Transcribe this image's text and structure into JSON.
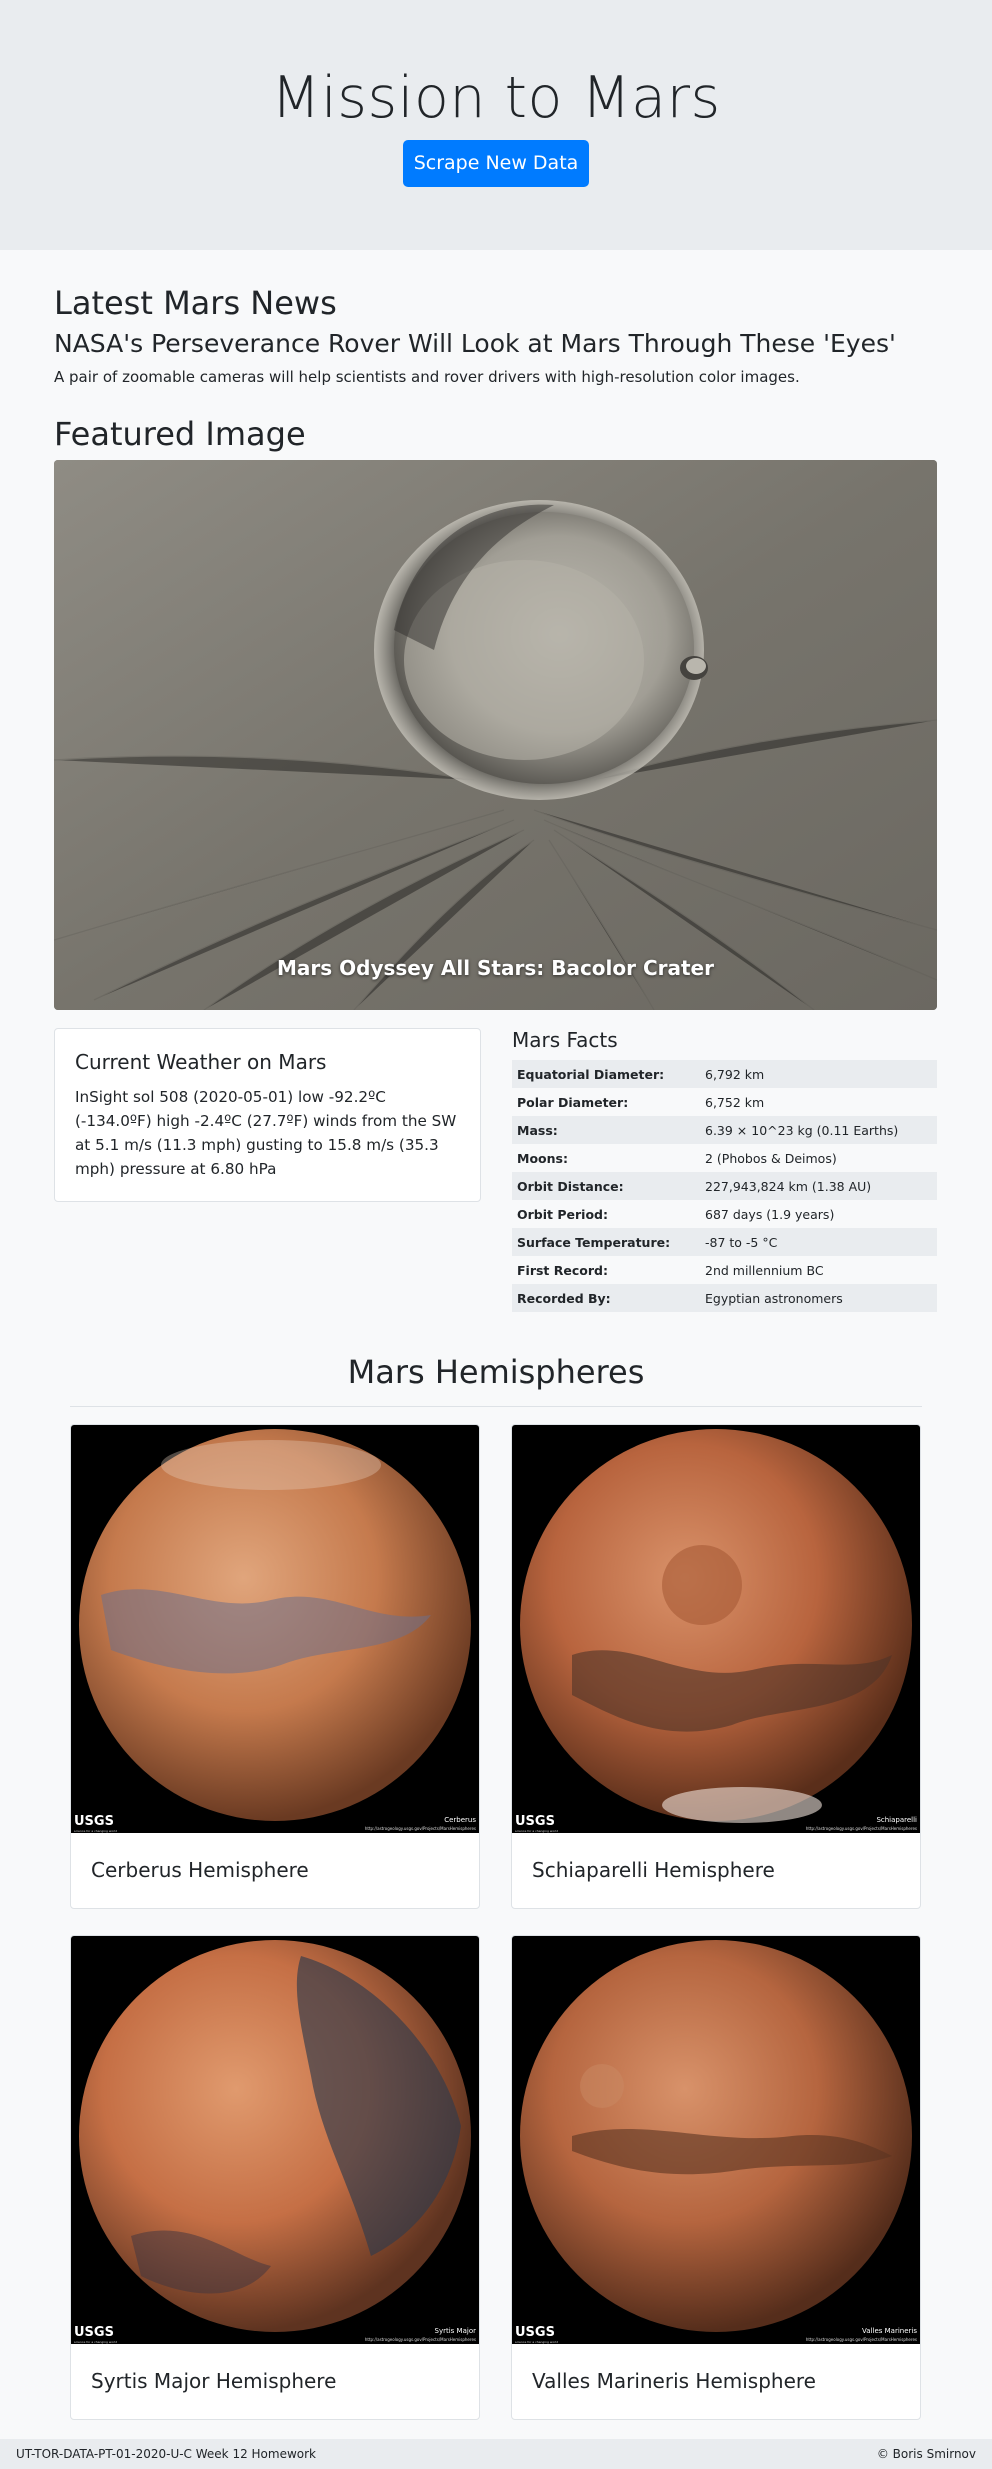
{
  "header": {
    "title": "Mission to Mars",
    "scrape_button": "Scrape New Data"
  },
  "news": {
    "heading": "Latest Mars News",
    "title": "NASA's Perseverance Rover Will Look at Mars Through These 'Eyes'",
    "teaser": "A pair of zoomable cameras will help scientists and rover drivers with high-resolution color images."
  },
  "featured": {
    "heading": "Featured Image",
    "caption": "Mars Odyssey All Stars: Bacolor Crater"
  },
  "weather": {
    "title": "Current Weather on Mars",
    "text": "InSight sol 508 (2020-05-01) low -92.2ºC (-134.0ºF) high -2.4ºC (27.7ºF) winds from the SW at 5.1 m/s (11.3 mph) gusting to 15.8 m/s (35.3 mph) pressure at 6.80 hPa"
  },
  "facts": {
    "title": "Mars Facts",
    "rows": [
      {
        "key": "Equatorial Diameter:",
        "value": "6,792 km"
      },
      {
        "key": "Polar Diameter:",
        "value": "6,752 km"
      },
      {
        "key": "Mass:",
        "value": "6.39 × 10^23 kg (0.11 Earths)"
      },
      {
        "key": "Moons:",
        "value": "2 (Phobos & Deimos)"
      },
      {
        "key": "Orbit Distance:",
        "value": "227,943,824 km (1.38 AU)"
      },
      {
        "key": "Orbit Period:",
        "value": "687 days (1.9 years)"
      },
      {
        "key": "Surface Temperature:",
        "value": "-87 to -5 °C"
      },
      {
        "key": "First Record:",
        "value": "2nd millennium BC"
      },
      {
        "key": "Recorded By:",
        "value": "Egyptian astronomers"
      }
    ]
  },
  "hemispheres": {
    "heading": "Mars Hemispheres",
    "logo_text": "USGS",
    "logo_sub": "science for a changing world",
    "url_text": "http://astrogeology.usgs.gov/Projects/MarsHemispheres",
    "items": [
      {
        "name": "Cerberus Hemisphere",
        "img_label": "Cerberus",
        "base": "#c57a4d",
        "dark": "#6d6f8a"
      },
      {
        "name": "Schiaparelli Hemisphere",
        "img_label": "Schiaparelli",
        "base": "#b8643e",
        "dark": "#4e3328"
      },
      {
        "name": "Syrtis Major Hemisphere",
        "img_label": "Syrtis Major",
        "base": "#c56f45",
        "dark": "#2f3a4c"
      },
      {
        "name": "Valles Marineris Hemisphere",
        "img_label": "Valles Marineris",
        "base": "#b5653f",
        "dark": "#5a3422"
      }
    ]
  },
  "footer": {
    "left": "UT-TOR-DATA-PT-01-2020-U-C Week 12 Homework",
    "right": "© Boris Smirnov"
  },
  "colors": {
    "primary": "#007bff",
    "jumbotron_bg": "#e9ecef",
    "page_bg": "#f8f9fa"
  }
}
